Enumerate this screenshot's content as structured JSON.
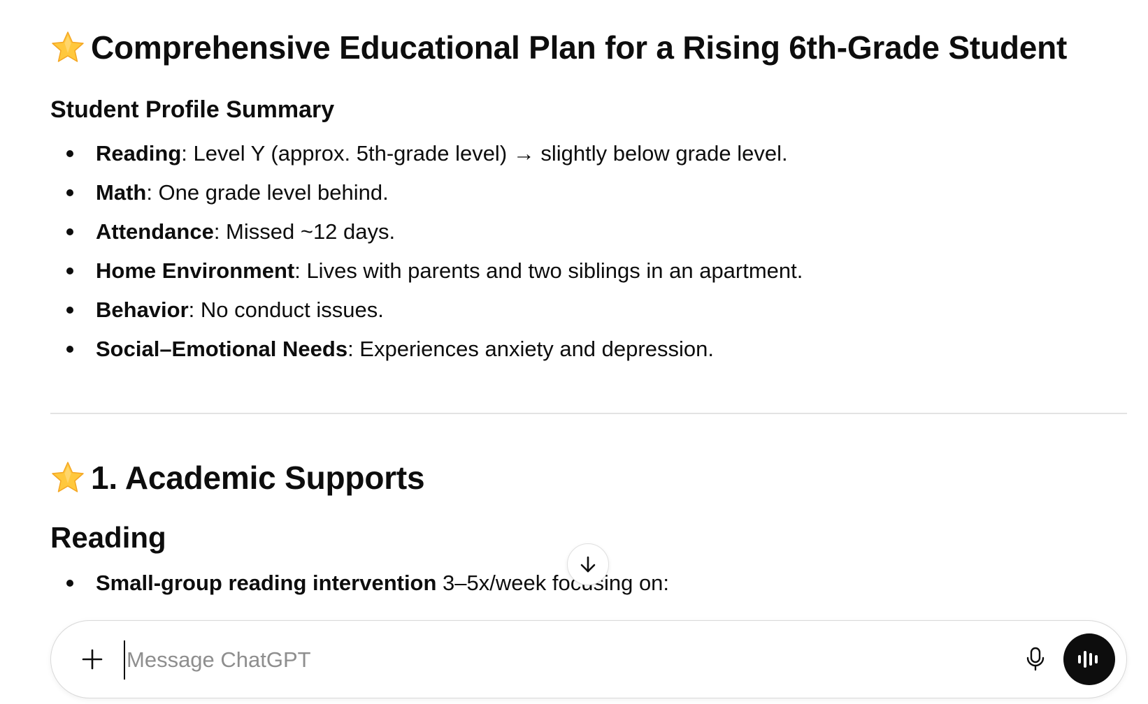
{
  "main_title": "Comprehensive Educational Plan for a Rising 6th-Grade Student",
  "profile_heading": "Student Profile Summary",
  "profile_items": [
    {
      "term": "Reading",
      "text": ": Level Y (approx. 5th-grade level) → slightly below grade level."
    },
    {
      "term": "Math",
      "text": ": One grade level behind."
    },
    {
      "term": "Attendance",
      "text": ": Missed ~12 days."
    },
    {
      "term": "Home Environment",
      "text": ": Lives with parents and two siblings in an apartment."
    },
    {
      "term": "Behavior",
      "text": ": No conduct issues."
    },
    {
      "term": "Social–Emotional Needs",
      "text": ": Experiences anxiety and depression."
    }
  ],
  "section1_title": "1. Academic Supports",
  "reading_heading": "Reading",
  "reading_items": [
    {
      "term": "Small-group reading intervention",
      "text": " 3–5x/week focusing on:"
    }
  ],
  "composer": {
    "placeholder": "Message ChatGPT"
  },
  "icons": {
    "star": "star-emoji-icon",
    "scroll_down": "arrow-down-icon",
    "plus": "plus-icon",
    "mic": "microphone-icon",
    "voice": "voice-mode-icon"
  },
  "colors": {
    "text": "#0d0d0d",
    "placeholder": "#8e8e8e",
    "divider": "#e3e3e3",
    "voice_button": "#0d0d0d",
    "star_fill": "#ffc83d"
  }
}
